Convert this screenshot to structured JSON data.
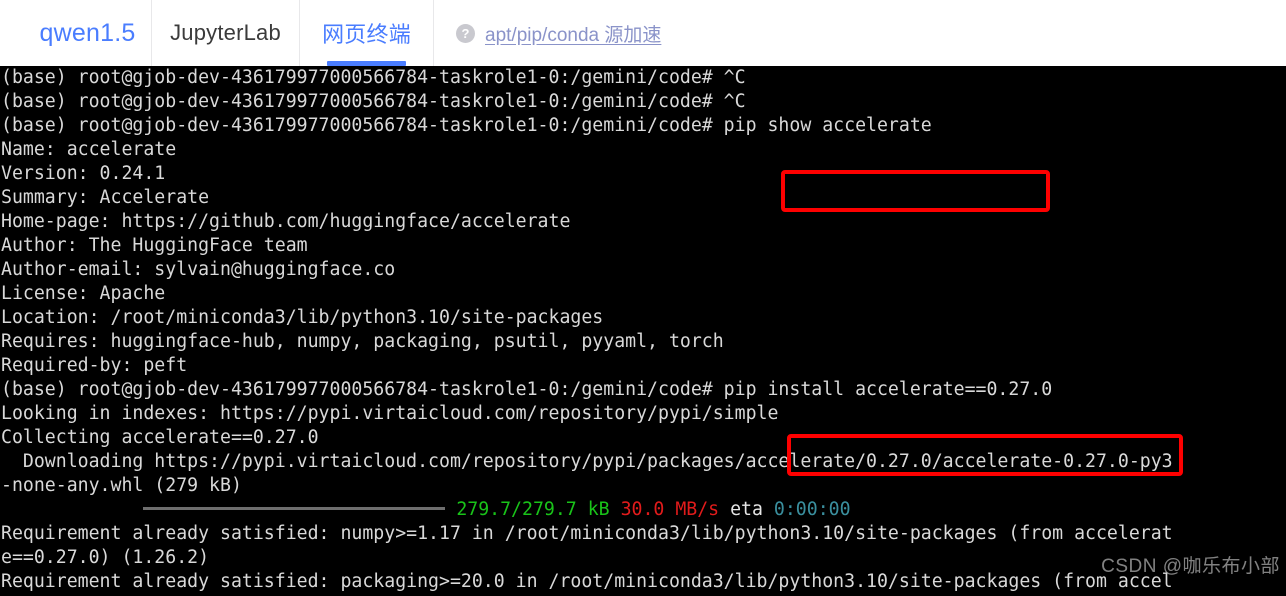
{
  "header": {
    "brand": "qwen1.5",
    "tabs": [
      {
        "label": "JupyterLab",
        "active": false
      },
      {
        "label": "网页终端",
        "active": true
      }
    ],
    "help_icon": "question-mark-icon",
    "help_link": "apt/pip/conda 源加速",
    "accent_color": "#4a7dff",
    "background": "#ffffff"
  },
  "terminal": {
    "background": "#000000",
    "foreground": "#d9d9d9",
    "prompt": "(base) root@gjob-dev-436179977000566784-taskrole1-0:/gemini/code#",
    "lines": [
      "(base) root@gjob-dev-436179977000566784-taskrole1-0:/gemini/code# ^C",
      "(base) root@gjob-dev-436179977000566784-taskrole1-0:/gemini/code# ^C",
      "(base) root@gjob-dev-436179977000566784-taskrole1-0:/gemini/code# pip show accelerate",
      "Name: accelerate",
      "Version: 0.24.1",
      "Summary: Accelerate",
      "Home-page: https://github.com/huggingface/accelerate",
      "Author: The HuggingFace team",
      "Author-email: sylvain@huggingface.co",
      "License: Apache",
      "Location: /root/miniconda3/lib/python3.10/site-packages",
      "Requires: huggingface-hub, numpy, packaging, psutil, pyyaml, torch",
      "Required-by: peft",
      "(base) root@gjob-dev-436179977000566784-taskrole1-0:/gemini/code# pip install accelerate==0.27.0",
      "Looking in indexes: https://pypi.virtaicloud.com/repository/pypi/simple",
      "Collecting accelerate==0.27.0",
      "  Downloading https://pypi.virtaicloud.com/repository/pypi/packages/accelerate/0.27.0/accelerate-0.27.0-py3",
      "-none-any.whl (279 kB)",
      "Requirement already satisfied: numpy>=1.17 in /root/miniconda3/lib/python3.10/site-packages (from accelerat",
      "e==0.27.0) (1.26.2)",
      "Requirement already satisfied: packaging>=20.0 in /root/miniconda3/lib/python3.10/site-packages (from accel"
    ],
    "progress_line": {
      "bar_glyph": "────────────────────────────────────────",
      "size": "279.7/279.7 kB",
      "speed": "30.0 MB/s",
      "eta_label": "eta",
      "eta_value": "0:00:00",
      "size_color": "#19c319",
      "speed_color": "#e11b1b",
      "eta_color": "#3a8f9e"
    },
    "commands": {
      "pip_show": "pip show accelerate",
      "pip_install": "pip install accelerate==0.27.0"
    }
  },
  "annotations": {
    "color": "#fe0000",
    "box1_target": "pip show accelerate",
    "box2_target": "pip install accelerate==0.27.0"
  },
  "watermark": "CSDN @咖乐布小部"
}
